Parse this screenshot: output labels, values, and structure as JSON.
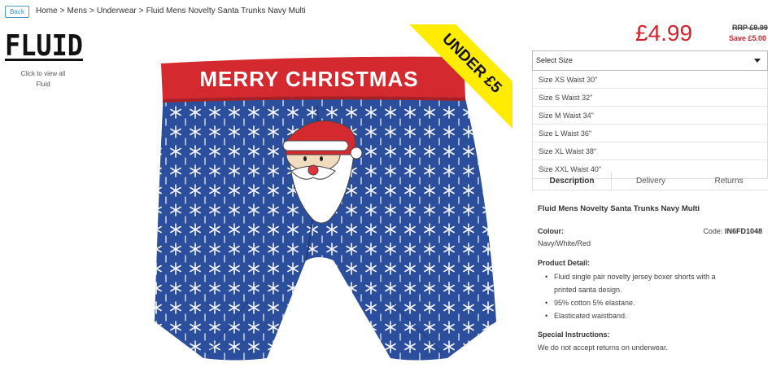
{
  "nav": {
    "back_label": "Back",
    "breadcrumb": [
      "Home",
      "Mens",
      "Underwear",
      "Fluid Mens Novelty Santa Trunks Navy Multi"
    ],
    "separator": ">"
  },
  "brand": {
    "logo_text": "FLUID",
    "view_all_line1": "Click to view all",
    "view_all_line2": "Fluid"
  },
  "product_image": {
    "waistband_text": "MERRY CHRISTMAS",
    "badge_text": "UNDER £5",
    "colors": {
      "navy": "#2b4f9c",
      "waistband": "#d42a2f",
      "badge": "#ffec00"
    }
  },
  "pricing": {
    "price": "£4.99",
    "rrp": "RRP £9.99",
    "save": "Save £5.00",
    "accent_color": "#d2232a"
  },
  "size": {
    "selected": "Select Size",
    "options": [
      "Size XS Waist 30\"",
      "Size S Waist 32\"",
      "Size M Waist 34\"",
      "Size L Waist 36\"",
      "Size XL Waist 38\"",
      "Size XXL Waist 40\""
    ]
  },
  "tabs": [
    "Description",
    "Delivery",
    "Returns"
  ],
  "description": {
    "title": "Fluid Mens Novelty Santa Trunks Navy Multi",
    "colour_label": "Colour:",
    "colour_value": "Navy/White/Red",
    "code_label": "Code:",
    "code_value": "IN6FD1048",
    "detail_label": "Product Detail:",
    "details": [
      "Fluid single pair novelty jersey boxer shorts with a",
      "printed santa design.",
      "95% cotton 5% elastane.",
      "Elasticated waistband."
    ],
    "instructions_label": "Special Instructions:",
    "instructions_value": "We do not accept returns on underwear."
  }
}
